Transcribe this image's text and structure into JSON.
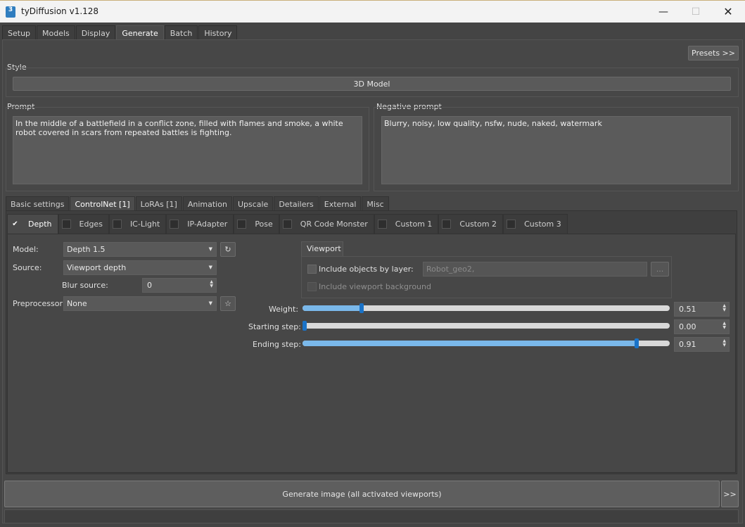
{
  "window": {
    "title": "tyDiffusion v1.128",
    "icon_label": "3",
    "minimize_glyph": "—",
    "maximize_glyph": "☐",
    "close_glyph": "✕"
  },
  "top_tabs": [
    "Setup",
    "Models",
    "Display",
    "Generate",
    "Batch",
    "History"
  ],
  "top_tab_active": "Generate",
  "presets_label": "Presets >>",
  "style": {
    "label": "Style",
    "value": "3D Model"
  },
  "prompt": {
    "label": "Prompt",
    "text": "In the middle of a battlefield in a conflict zone, filled with flames and smoke, a white robot covered in scars from repeated battles is fighting."
  },
  "negative_prompt": {
    "label": "Negative prompt",
    "text": "Blurry, noisy, low quality, nsfw, nude, naked, watermark"
  },
  "sub_tabs": [
    "Basic settings",
    "ControlNet [1]",
    "LoRAs [1]",
    "Animation",
    "Upscale",
    "Detailers",
    "External",
    "Misc"
  ],
  "sub_tab_active": "ControlNet [1]",
  "controlnet_tabs": [
    {
      "label": "Depth",
      "checked": true
    },
    {
      "label": "Edges",
      "checked": false
    },
    {
      "label": "IC-Light",
      "checked": false
    },
    {
      "label": "IP-Adapter",
      "checked": false
    },
    {
      "label": "Pose",
      "checked": false
    },
    {
      "label": "QR Code Monster",
      "checked": false
    },
    {
      "label": "Custom 1",
      "checked": false
    },
    {
      "label": "Custom 2",
      "checked": false
    },
    {
      "label": "Custom 3",
      "checked": false
    }
  ],
  "check_glyph": "✔",
  "settings": {
    "model_label": "Model:",
    "model_value": "Depth 1.5",
    "model_refresh_glyph": "↻",
    "source_label": "Source:",
    "source_value": "Viewport depth",
    "blur_label": "Blur source:",
    "blur_value": "0",
    "preprocessor_label": "Preprocessor:",
    "preprocessor_value": "None",
    "preprocessor_star_glyph": "☆"
  },
  "viewport": {
    "tab_label": "Viewport",
    "include_objects_label": "Include objects by layer:",
    "layer_value": "Robot_geo2,",
    "browse_label": "...",
    "include_background_label": "Include viewport background"
  },
  "sliders": {
    "weight_label": "Weight:",
    "weight_value": "0.51",
    "weight": 0.16,
    "starting_label": "Starting step:",
    "starting_value": "0.00",
    "starting": 0.0,
    "ending_label": "Ending step:",
    "ending_value": "0.91",
    "ending": 0.91
  },
  "generate": {
    "label": "Generate image (all activated viewports)",
    "more_label": ">>"
  }
}
